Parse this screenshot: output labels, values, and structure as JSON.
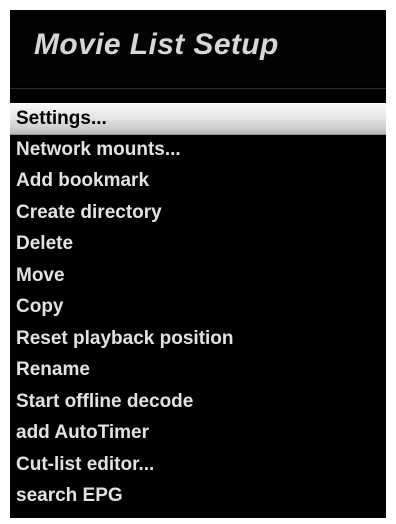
{
  "title": "Movie List Setup",
  "menu": {
    "selected_index": 0,
    "items": [
      {
        "label": "Settings..."
      },
      {
        "label": "Network mounts..."
      },
      {
        "label": "Add bookmark"
      },
      {
        "label": "Create directory"
      },
      {
        "label": "Delete"
      },
      {
        "label": "Move"
      },
      {
        "label": "Copy"
      },
      {
        "label": "Reset playback position"
      },
      {
        "label": "Rename"
      },
      {
        "label": "Start offline decode"
      },
      {
        "label": "add AutoTimer"
      },
      {
        "label": "Cut-list editor..."
      },
      {
        "label": "search EPG"
      }
    ]
  },
  "colors": {
    "background": "#000000",
    "text": "#e2e2e2",
    "title_text": "#d7d7d7",
    "selection_bar": "#e0e0e0",
    "selected_text": "#000000"
  }
}
